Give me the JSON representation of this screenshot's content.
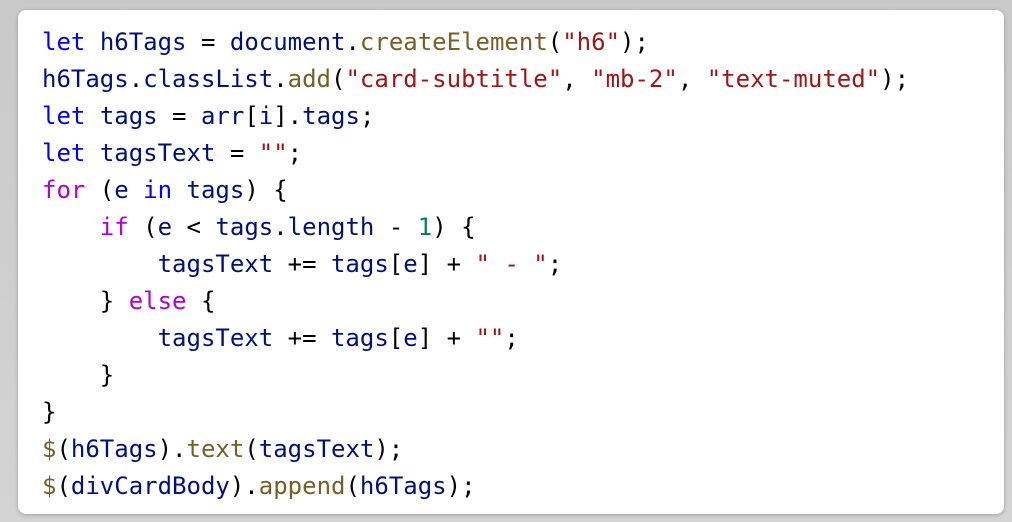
{
  "colors": {
    "keyword": "#0000ff",
    "control": "#af00db",
    "identifier": "#001080",
    "function": "#795e26",
    "string": "#a31515",
    "number": "#098658",
    "punctuation": "#000000"
  },
  "code_lines": [
    [
      {
        "t": "let",
        "c": "kw"
      },
      {
        "t": " ",
        "c": "pun"
      },
      {
        "t": "h6Tags",
        "c": "id"
      },
      {
        "t": " = ",
        "c": "pun"
      },
      {
        "t": "document",
        "c": "id"
      },
      {
        "t": ".",
        "c": "pun"
      },
      {
        "t": "createElement",
        "c": "fn"
      },
      {
        "t": "(",
        "c": "pun"
      },
      {
        "t": "\"h6\"",
        "c": "str"
      },
      {
        "t": ");",
        "c": "pun"
      }
    ],
    [
      {
        "t": "h6Tags",
        "c": "id"
      },
      {
        "t": ".",
        "c": "pun"
      },
      {
        "t": "classList",
        "c": "id"
      },
      {
        "t": ".",
        "c": "pun"
      },
      {
        "t": "add",
        "c": "fn"
      },
      {
        "t": "(",
        "c": "pun"
      },
      {
        "t": "\"card-subtitle\"",
        "c": "str"
      },
      {
        "t": ", ",
        "c": "pun"
      },
      {
        "t": "\"mb-2\"",
        "c": "str"
      },
      {
        "t": ", ",
        "c": "pun"
      },
      {
        "t": "\"text-muted\"",
        "c": "str"
      },
      {
        "t": ");",
        "c": "pun"
      }
    ],
    [
      {
        "t": "let",
        "c": "kw"
      },
      {
        "t": " ",
        "c": "pun"
      },
      {
        "t": "tags",
        "c": "id"
      },
      {
        "t": " = ",
        "c": "pun"
      },
      {
        "t": "arr",
        "c": "id"
      },
      {
        "t": "[",
        "c": "pun"
      },
      {
        "t": "i",
        "c": "id"
      },
      {
        "t": "].",
        "c": "pun"
      },
      {
        "t": "tags",
        "c": "id"
      },
      {
        "t": ";",
        "c": "pun"
      }
    ],
    [
      {
        "t": "let",
        "c": "kw"
      },
      {
        "t": " ",
        "c": "pun"
      },
      {
        "t": "tagsText",
        "c": "id"
      },
      {
        "t": " = ",
        "c": "pun"
      },
      {
        "t": "\"\"",
        "c": "str"
      },
      {
        "t": ";",
        "c": "pun"
      }
    ],
    [
      {
        "t": "for",
        "c": "ctl"
      },
      {
        "t": " (",
        "c": "pun"
      },
      {
        "t": "e",
        "c": "id"
      },
      {
        "t": " ",
        "c": "pun"
      },
      {
        "t": "in",
        "c": "kw"
      },
      {
        "t": " ",
        "c": "pun"
      },
      {
        "t": "tags",
        "c": "id"
      },
      {
        "t": ") {",
        "c": "pun"
      }
    ],
    [
      {
        "t": "    ",
        "c": "pun"
      },
      {
        "t": "if",
        "c": "ctl"
      },
      {
        "t": " (",
        "c": "pun"
      },
      {
        "t": "e",
        "c": "id"
      },
      {
        "t": " < ",
        "c": "pun"
      },
      {
        "t": "tags",
        "c": "id"
      },
      {
        "t": ".",
        "c": "pun"
      },
      {
        "t": "length",
        "c": "id"
      },
      {
        "t": " - ",
        "c": "pun"
      },
      {
        "t": "1",
        "c": "num"
      },
      {
        "t": ") {",
        "c": "pun"
      }
    ],
    [
      {
        "t": "        ",
        "c": "pun"
      },
      {
        "t": "tagsText",
        "c": "id"
      },
      {
        "t": " += ",
        "c": "pun"
      },
      {
        "t": "tags",
        "c": "id"
      },
      {
        "t": "[",
        "c": "pun"
      },
      {
        "t": "e",
        "c": "id"
      },
      {
        "t": "] + ",
        "c": "pun"
      },
      {
        "t": "\" - \"",
        "c": "str"
      },
      {
        "t": ";",
        "c": "pun"
      }
    ],
    [
      {
        "t": "    } ",
        "c": "pun"
      },
      {
        "t": "else",
        "c": "ctl"
      },
      {
        "t": " {",
        "c": "pun"
      }
    ],
    [
      {
        "t": "        ",
        "c": "pun"
      },
      {
        "t": "tagsText",
        "c": "id"
      },
      {
        "t": " += ",
        "c": "pun"
      },
      {
        "t": "tags",
        "c": "id"
      },
      {
        "t": "[",
        "c": "pun"
      },
      {
        "t": "e",
        "c": "id"
      },
      {
        "t": "] + ",
        "c": "pun"
      },
      {
        "t": "\"\"",
        "c": "str"
      },
      {
        "t": ";",
        "c": "pun"
      }
    ],
    [
      {
        "t": "    }",
        "c": "pun"
      }
    ],
    [
      {
        "t": "}",
        "c": "pun"
      }
    ],
    [
      {
        "t": "$",
        "c": "fn"
      },
      {
        "t": "(",
        "c": "pun"
      },
      {
        "t": "h6Tags",
        "c": "id"
      },
      {
        "t": ").",
        "c": "pun"
      },
      {
        "t": "text",
        "c": "fn"
      },
      {
        "t": "(",
        "c": "pun"
      },
      {
        "t": "tagsText",
        "c": "id"
      },
      {
        "t": ");",
        "c": "pun"
      }
    ],
    [
      {
        "t": "$",
        "c": "fn"
      },
      {
        "t": "(",
        "c": "pun"
      },
      {
        "t": "divCardBody",
        "c": "id"
      },
      {
        "t": ").",
        "c": "pun"
      },
      {
        "t": "append",
        "c": "fn"
      },
      {
        "t": "(",
        "c": "pun"
      },
      {
        "t": "h6Tags",
        "c": "id"
      },
      {
        "t": ");",
        "c": "pun"
      }
    ]
  ]
}
